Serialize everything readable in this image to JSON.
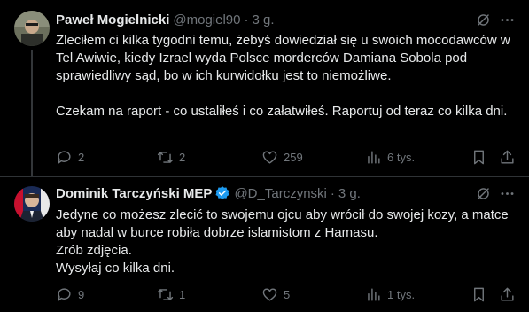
{
  "tweets": [
    {
      "name": "Paweł Mogielnicki",
      "handle": "@mogiel90",
      "time": "3 g.",
      "text": "Zleciłem ci kilka tygodni temu, żebyś dowiedział się u swoich mocodawców w Tel Awiwie, kiedy Izrael wyda Polsce morderców Damiana Sobola pod sprawiedliwy sąd, bo w ich kurwidołku jest to niemożliwe.\n\nCzekam na raport - co ustaliłeś i co załatwiłeś. Raportuj od teraz co kilka dni.",
      "replies": "2",
      "reposts": "2",
      "likes": "259",
      "views": "6 tys."
    },
    {
      "name": "Dominik Tarczyński MEP",
      "handle": "@D_Tarczynski",
      "time": "3 g.",
      "text": "Jedyne co możesz zlecić to swojemu ojcu aby wrócił do swojej kozy, a matce aby nadal w burce robiła dobrze islamistom z Hamasu.\nZrób zdjęcia.\nWysyłaj co kilka dni.",
      "replies": "9",
      "reposts": "1",
      "likes": "5",
      "views": "1 tys."
    }
  ],
  "colors": {
    "background": "#000000",
    "text": "#e7e9ea",
    "muted": "#71767b",
    "verified": "#1d9bf0"
  }
}
